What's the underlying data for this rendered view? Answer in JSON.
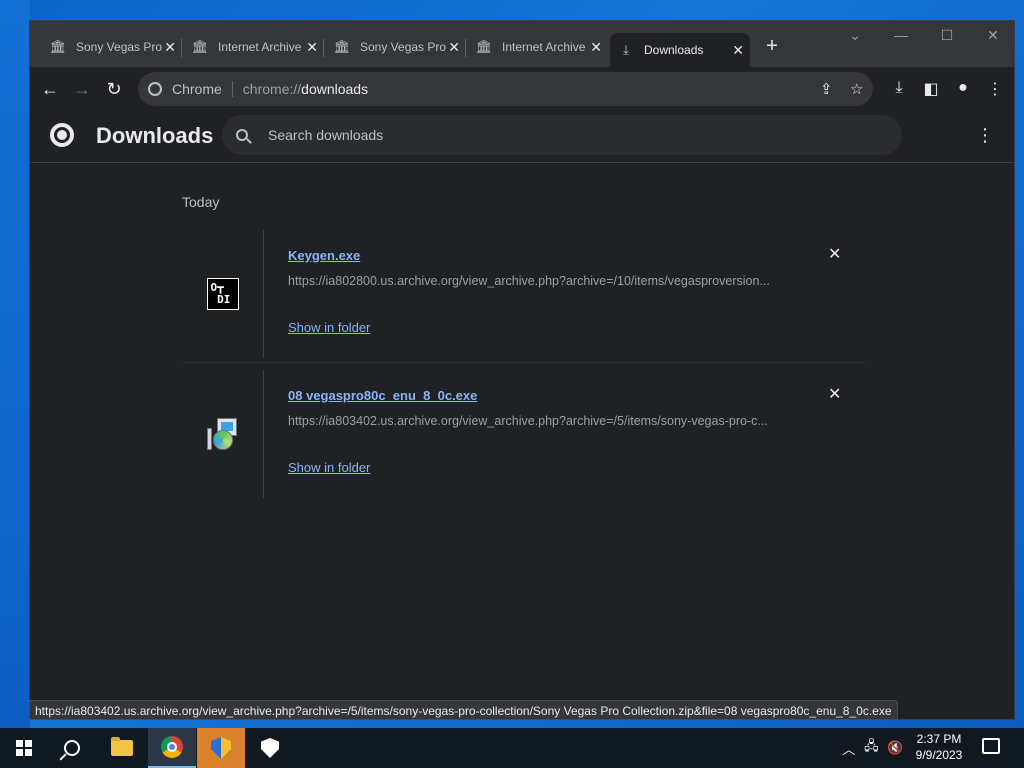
{
  "browser": {
    "tabs": [
      {
        "title": "Sony Vegas Pro",
        "icon": "archive-icon",
        "active": false
      },
      {
        "title": "Internet Archive",
        "icon": "archive-icon",
        "active": false
      },
      {
        "title": "Sony Vegas Pro",
        "icon": "archive-icon",
        "active": false
      },
      {
        "title": "Internet Archive",
        "icon": "archive-icon",
        "active": false
      },
      {
        "title": "Downloads",
        "icon": "download-icon",
        "active": true
      }
    ],
    "omnibox": {
      "site_label": "Chrome",
      "url_scheme": "chrome://",
      "url_path": "downloads"
    }
  },
  "downloads_page": {
    "title": "Downloads",
    "search_placeholder": "Search downloads",
    "date_group": "Today",
    "items": [
      {
        "filename": "Keygen.exe",
        "url": "https://ia802800.us.archive.org/view_archive.php?archive=/10/items/vegasproversion...",
        "action": "Show in folder",
        "icon": "keygen-icon"
      },
      {
        "filename": "08 vegaspro80c_enu_8_0c.exe",
        "url": "https://ia803402.us.archive.org/view_archive.php?archive=/5/items/sony-vegas-pro-c...",
        "action": "Show in folder",
        "icon": "installer-icon"
      }
    ]
  },
  "status_bar": {
    "text": "https://ia803402.us.archive.org/view_archive.php?archive=/5/items/sony-vegas-pro-collection/Sony Vegas Pro Collection.zip&file=08 vegaspro80c_enu_8_0c.exe"
  },
  "taskbar": {
    "clock_time": "2:37 PM",
    "clock_date": "9/9/2023"
  },
  "colors": {
    "accent_link": "#8ab4f8",
    "page_bg": "#202124",
    "tab_strip_bg": "#35363a"
  }
}
